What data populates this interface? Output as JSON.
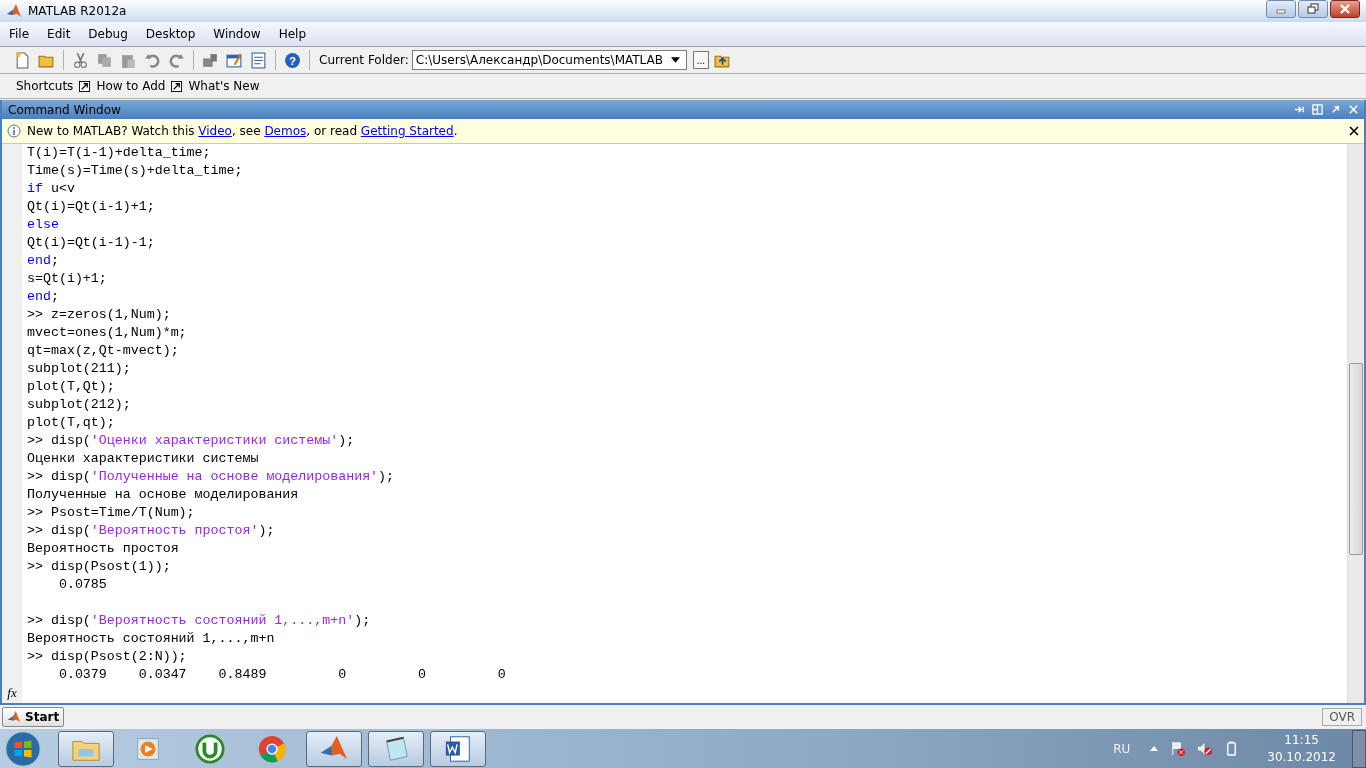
{
  "window": {
    "title": "MATLAB  R2012a"
  },
  "menu": [
    "File",
    "Edit",
    "Debug",
    "Desktop",
    "Window",
    "Help"
  ],
  "toolbar": {
    "current_folder_label": "Current Folder:",
    "current_folder": "C:\\Users\\Александр\\Documents\\MATLAB",
    "browse_button": "...",
    "help_icon": "?"
  },
  "shortcuts": {
    "label": "Shortcuts",
    "items": [
      "How to Add",
      "What's New"
    ]
  },
  "command_window": {
    "title": "Command Window",
    "info_bar": {
      "parts": [
        {
          "kind": "text",
          "text": "New to MATLAB? Watch this "
        },
        {
          "kind": "link",
          "text": "Video"
        },
        {
          "kind": "text",
          "text": ", see "
        },
        {
          "kind": "link",
          "text": "Demos"
        },
        {
          "kind": "text",
          "text": ", or read "
        },
        {
          "kind": "link",
          "text": "Getting Started"
        },
        {
          "kind": "text",
          "text": "."
        }
      ]
    },
    "function_browser": "fx",
    "lines": [
      [
        {
          "kind": "code",
          "text": "T(i)=T(i-1)+delta_time;"
        }
      ],
      [
        {
          "kind": "code",
          "text": "Time(s)=Time(s)+delta_time;"
        }
      ],
      [
        {
          "kind": "keyword",
          "text": "if"
        },
        {
          "kind": "code",
          "text": " u<v"
        }
      ],
      [
        {
          "kind": "code",
          "text": "Qt(i)=Qt(i-1)+1;"
        }
      ],
      [
        {
          "kind": "keyword",
          "text": "else"
        }
      ],
      [
        {
          "kind": "code",
          "text": "Qt(i)=Qt(i-1)-1;"
        }
      ],
      [
        {
          "kind": "keyword",
          "text": "end"
        },
        {
          "kind": "code",
          "text": ";"
        }
      ],
      [
        {
          "kind": "code",
          "text": "s=Qt(i)+1;"
        }
      ],
      [
        {
          "kind": "keyword",
          "text": "end"
        },
        {
          "kind": "code",
          "text": ";"
        }
      ],
      [
        {
          "kind": "code",
          "text": ">> z=zeros(1,Num);"
        }
      ],
      [
        {
          "kind": "code",
          "text": "mvect=ones(1,Num)*m;"
        }
      ],
      [
        {
          "kind": "code",
          "text": "qt=max(z,Qt-mvect);"
        }
      ],
      [
        {
          "kind": "code",
          "text": "subplot(211);"
        }
      ],
      [
        {
          "kind": "code",
          "text": "plot(T,Qt);"
        }
      ],
      [
        {
          "kind": "code",
          "text": "subplot(212);"
        }
      ],
      [
        {
          "kind": "code",
          "text": "plot(T,qt);"
        }
      ],
      [
        {
          "kind": "code",
          "text": ">> disp("
        },
        {
          "kind": "string",
          "text": "'Оценки характеристики системы'"
        },
        {
          "kind": "code",
          "text": ");"
        }
      ],
      [
        {
          "kind": "code",
          "text": "Оценки характеристики системы"
        }
      ],
      [
        {
          "kind": "code",
          "text": ">> disp("
        },
        {
          "kind": "string",
          "text": "'Полученные на основе моделирования'"
        },
        {
          "kind": "code",
          "text": ");"
        }
      ],
      [
        {
          "kind": "code",
          "text": "Полученные на основе моделирования"
        }
      ],
      [
        {
          "kind": "code",
          "text": ">> Psost=Time/T(Num);"
        }
      ],
      [
        {
          "kind": "code",
          "text": ">> disp("
        },
        {
          "kind": "string",
          "text": "'Вероятность простоя'"
        },
        {
          "kind": "code",
          "text": ");"
        }
      ],
      [
        {
          "kind": "code",
          "text": "Вероятность простоя"
        }
      ],
      [
        {
          "kind": "code",
          "text": ">> disp(Psost(1));"
        }
      ],
      [
        {
          "kind": "code",
          "text": "    0.0785"
        }
      ],
      {
        "kind": "blank"
      },
      [
        {
          "kind": "code",
          "text": ">> disp("
        },
        {
          "kind": "string",
          "text": "'Вероятность состояний 1,...,m+n'"
        },
        {
          "kind": "code",
          "text": ");"
        }
      ],
      [
        {
          "kind": "code",
          "text": "Вероятность состояний 1,...,m+n"
        }
      ],
      [
        {
          "kind": "code",
          "text": ">> disp(Psost(2:N));"
        }
      ],
      [
        {
          "kind": "code",
          "text": "    0.0379    0.0347    0.8489         0         0         0"
        }
      ]
    ]
  },
  "start_button": "Start",
  "status_bar": {
    "mode": "OVR"
  },
  "taskbar": {
    "apps": [
      {
        "kind": "folder",
        "selected": true
      },
      {
        "kind": "media",
        "selected": false
      },
      {
        "kind": "torrent",
        "selected": false
      },
      {
        "kind": "chrome",
        "selected": false
      },
      {
        "kind": "matlab",
        "selected": true
      },
      {
        "kind": "notepad",
        "selected": true
      },
      {
        "kind": "word",
        "selected": true
      }
    ],
    "language": "RU",
    "time": "11:15",
    "date": "30.10.2012"
  }
}
